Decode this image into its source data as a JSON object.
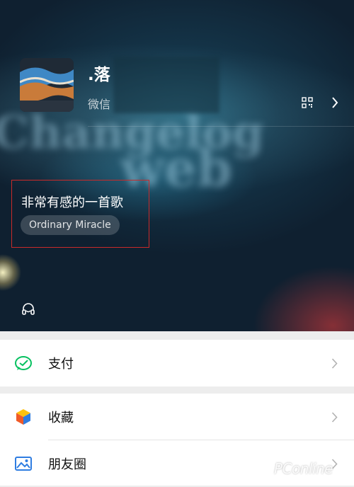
{
  "profile": {
    "name": ".落",
    "wechat_id_label": "微信",
    "status_text": "非常有感的一首歌",
    "status_song": "Ordinary Miracle"
  },
  "menu": [
    {
      "label": "支付",
      "icon": "wechat-pay-icon"
    },
    {
      "label": "收藏",
      "icon": "favorites-cube-icon"
    },
    {
      "label": "朋友圈",
      "icon": "moments-picture-icon"
    }
  ],
  "watermark": "PConline",
  "colors": {
    "pay_green": "#07c160",
    "highlight_box": "#c92a2a",
    "moments_blue": "#2f7de1"
  }
}
